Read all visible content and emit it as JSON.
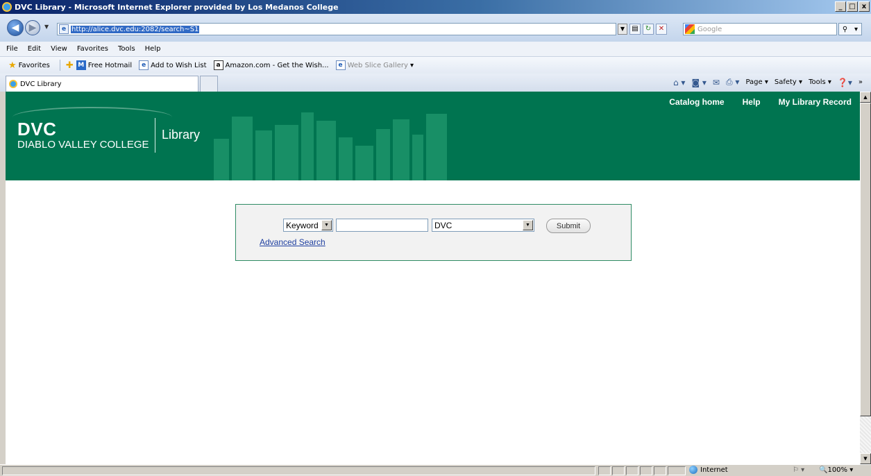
{
  "window": {
    "title": "DVC Library - Microsoft Internet Explorer provided by Los Medanos College",
    "minimize": "_",
    "maximize": "□",
    "close": "x"
  },
  "address": {
    "url": "http://alice.dvc.edu:2082/search~S1",
    "search_placeholder": "Google"
  },
  "menu": [
    "File",
    "Edit",
    "View",
    "Favorites",
    "Tools",
    "Help"
  ],
  "favorites": {
    "label": "Favorites",
    "items": [
      "Free Hotmail",
      "Add to Wish List",
      "Amazon.com - Get the Wish...",
      "Web Slice Gallery"
    ]
  },
  "tab": {
    "title": "DVC Library"
  },
  "command_bar": {
    "page": "Page",
    "safety": "Safety",
    "tools": "Tools"
  },
  "banner": {
    "logo": "DVC",
    "college": "DIABLO VALLEY COLLEGE",
    "section": "Library",
    "nav": [
      "Catalog home",
      "Help",
      "My Library Record"
    ]
  },
  "search": {
    "search_type": "Keyword",
    "query": "",
    "scope": "DVC",
    "submit": "Submit",
    "advanced": "Advanced Search"
  },
  "status": {
    "zone": "Internet",
    "zoom": "100%"
  },
  "colors": {
    "banner": "#007450",
    "panel_border": "#2e8b63",
    "link": "#1f3fa0"
  }
}
